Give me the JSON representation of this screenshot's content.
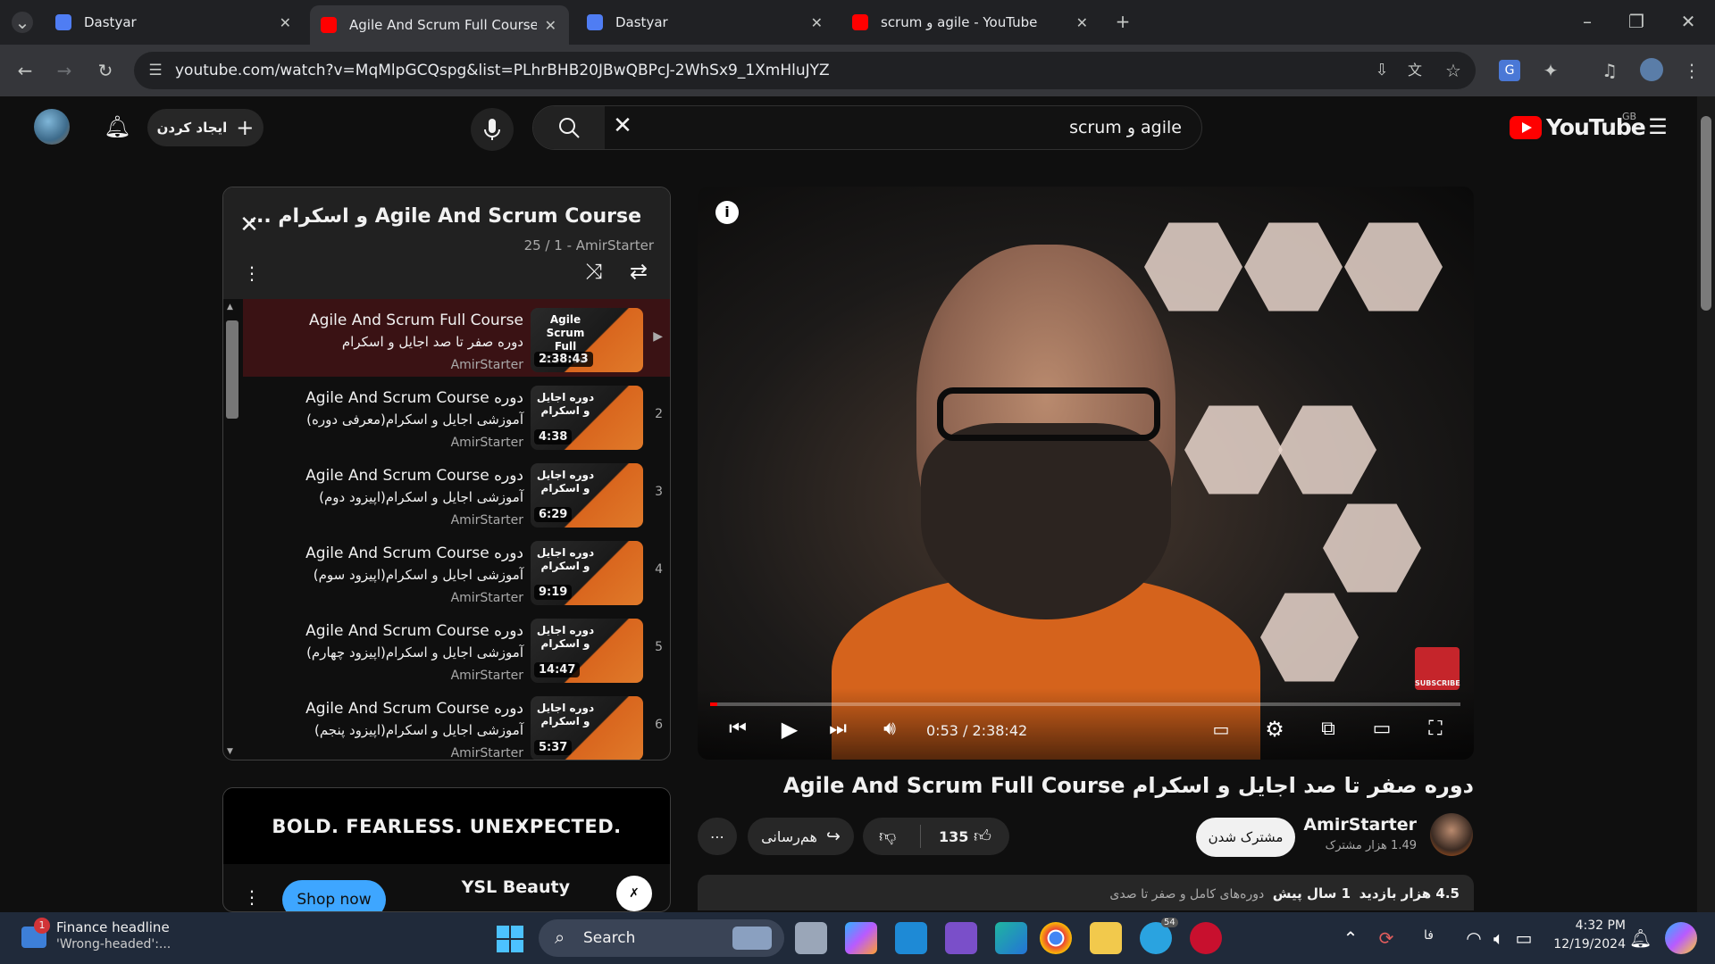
{
  "browser": {
    "tabs": [
      {
        "label": "Dastyar",
        "active": false
      },
      {
        "label": "Agile And Scrum Full Course و اسکرام",
        "active": true
      },
      {
        "label": "Dastyar",
        "active": false
      },
      {
        "label": "scrum و agile - YouTube",
        "active": false
      }
    ],
    "url": "youtube.com/watch?v=MqMlpGCQspg&list=PLhrBHB20JBwQBPcJ-2WhSx9_1XmHluJYZ"
  },
  "youtube": {
    "logo": "YouTube",
    "region": "GB",
    "search_query": "scrum و agile",
    "create_label": "ایجاد کردن"
  },
  "playlist": {
    "title": "Agile And Scrum Course  و اسکرام ...",
    "meta": "25 / 1 - AmirStarter",
    "items": [
      {
        "title1": "Agile And Scrum Full Course",
        "title2": "دوره صفر تا صد اجایل و اسکرام",
        "channel": "AmirStarter",
        "duration": "2:38:43",
        "thumb_text": "Agile Scrum Full Course",
        "index": "▶"
      },
      {
        "title1": "Agile And Scrum Course دوره",
        "title2": "آموزشی اجایل و اسکرام(معرفی دوره)",
        "channel": "AmirStarter",
        "duration": "4:38",
        "thumb_text": "دوره اجایل و اسکرام",
        "index": "2"
      },
      {
        "title1": "Agile And Scrum Course دوره",
        "title2": "آموزشی اجایل و اسکرام(اپیزود دوم)",
        "channel": "AmirStarter",
        "duration": "6:29",
        "thumb_text": "دوره اجایل و اسکرام",
        "index": "3"
      },
      {
        "title1": "Agile And Scrum Course دوره",
        "title2": "آموزشی اجایل و اسکرام(اپیزود سوم)",
        "channel": "AmirStarter",
        "duration": "9:19",
        "thumb_text": "دوره اجایل و اسکرام",
        "index": "4"
      },
      {
        "title1": "Agile And Scrum Course دوره",
        "title2": "آموزشی اجایل و اسکرام(اپیزود چهارم)",
        "channel": "AmirStarter",
        "duration": "14:47",
        "thumb_text": "دوره اجایل و اسکرام",
        "index": "5"
      },
      {
        "title1": "Agile And Scrum Course دوره",
        "title2": "آموزشی اجایل و اسکرام(اپیزود پنجم)",
        "channel": "AmirStarter",
        "duration": "5:37",
        "thumb_text": "دوره اجایل و اسکرام",
        "index": "6"
      }
    ]
  },
  "ad": {
    "banner": "BOLD. FEARLESS. UNEXPECTED.",
    "shop_label": "Shop now",
    "advertiser": "YSL Beauty"
  },
  "player": {
    "time": "0:53 / 2:38:42",
    "progress": 0.0056,
    "subscribe_badge": "SUBSCRIBE"
  },
  "video": {
    "title": "دوره صفر تا صد اجایل و اسکرام Agile And Scrum Full Course",
    "channel": "AmirStarter",
    "subscribers": "1.49 هزار مشترک",
    "subscribe_label": "مشترک شدن",
    "likes": "135",
    "share_label": "هم‌رسانی",
    "views": "4.5 هزار بازدید",
    "age": "1 سال پیش",
    "desc_snippet": "دوره‌های کامل و صفر تا صدی"
  },
  "taskbar": {
    "news_title": "Finance headline",
    "news_sub": "'Wrong-headed':...",
    "news_badge": "1",
    "search_label": "Search",
    "lang": "فا",
    "time": "4:32 PM",
    "date": "12/19/2024",
    "telegram_badge": "54"
  }
}
